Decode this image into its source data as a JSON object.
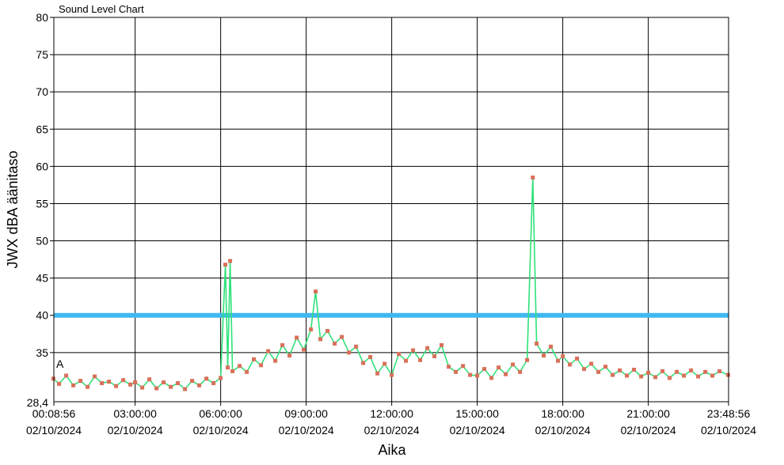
{
  "chart_data": {
    "type": "line",
    "title": "Sound Level Chart",
    "xlabel": "Aika",
    "ylabel": "JWX dBA äänitaso",
    "ylim": [
      28.4,
      80
    ],
    "yticks": [
      80,
      75,
      70,
      65,
      60,
      55,
      50,
      45,
      40,
      35
    ],
    "ymin_label": "28,4",
    "xlim": [
      "00:08:56",
      "23:48:56"
    ],
    "xticks": [
      {
        "time": "00:08:56",
        "date": "02/10/2024"
      },
      {
        "time": "03:00:00",
        "date": "02/10/2024"
      },
      {
        "time": "06:00:00",
        "date": "02/10/2024"
      },
      {
        "time": "09:00:00",
        "date": "02/10/2024"
      },
      {
        "time": "12:00:00",
        "date": "02/10/2024"
      },
      {
        "time": "15:00:00",
        "date": "02/10/2024"
      },
      {
        "time": "18:00:00",
        "date": "02/10/2024"
      },
      {
        "time": "21:00:00",
        "date": "02/10/2024"
      },
      {
        "time": "23:48:56",
        "date": "02/10/2024"
      }
    ],
    "grid": true,
    "threshold": {
      "value": 40,
      "color": "#3fb8ef"
    },
    "annotation": "A",
    "series": [
      {
        "line_color": "#2fe27a",
        "marker_color": "#d9705a",
        "points": [
          [
            "00:08",
            31.5
          ],
          [
            "00:20",
            30.8
          ],
          [
            "00:35",
            31.9
          ],
          [
            "00:50",
            30.6
          ],
          [
            "01:05",
            31.2
          ],
          [
            "01:20",
            30.4
          ],
          [
            "01:35",
            31.8
          ],
          [
            "01:50",
            30.9
          ],
          [
            "02:05",
            31.1
          ],
          [
            "02:20",
            30.5
          ],
          [
            "02:35",
            31.3
          ],
          [
            "02:50",
            30.7
          ],
          [
            "03:00",
            31.0
          ],
          [
            "03:15",
            30.3
          ],
          [
            "03:30",
            31.4
          ],
          [
            "03:45",
            30.2
          ],
          [
            "04:00",
            31.0
          ],
          [
            "04:15",
            30.4
          ],
          [
            "04:30",
            30.9
          ],
          [
            "04:45",
            30.1
          ],
          [
            "05:00",
            31.2
          ],
          [
            "05:15",
            30.6
          ],
          [
            "05:30",
            31.5
          ],
          [
            "05:45",
            30.9
          ],
          [
            "06:00",
            31.6
          ],
          [
            "06:10",
            46.8
          ],
          [
            "06:15",
            33.0
          ],
          [
            "06:20",
            47.3
          ],
          [
            "06:25",
            32.5
          ],
          [
            "06:40",
            33.2
          ],
          [
            "06:55",
            32.4
          ],
          [
            "07:10",
            34.1
          ],
          [
            "07:25",
            33.3
          ],
          [
            "07:40",
            35.2
          ],
          [
            "07:55",
            33.9
          ],
          [
            "08:10",
            36.0
          ],
          [
            "08:25",
            34.6
          ],
          [
            "08:40",
            37.0
          ],
          [
            "08:55",
            35.4
          ],
          [
            "09:10",
            38.1
          ],
          [
            "09:20",
            43.2
          ],
          [
            "09:30",
            36.8
          ],
          [
            "09:45",
            37.9
          ],
          [
            "10:00",
            36.2
          ],
          [
            "10:15",
            37.1
          ],
          [
            "10:30",
            35.0
          ],
          [
            "10:45",
            35.8
          ],
          [
            "11:00",
            33.6
          ],
          [
            "11:15",
            34.4
          ],
          [
            "11:30",
            32.2
          ],
          [
            "11:45",
            33.5
          ],
          [
            "12:00",
            32.0
          ],
          [
            "12:15",
            34.8
          ],
          [
            "12:30",
            33.9
          ],
          [
            "12:45",
            35.3
          ],
          [
            "13:00",
            34.0
          ],
          [
            "13:15",
            35.6
          ],
          [
            "13:30",
            34.5
          ],
          [
            "13:45",
            36.0
          ],
          [
            "14:00",
            33.1
          ],
          [
            "14:15",
            32.4
          ],
          [
            "14:30",
            33.2
          ],
          [
            "14:45",
            32.0
          ],
          [
            "15:00",
            31.9
          ],
          [
            "15:15",
            32.8
          ],
          [
            "15:30",
            31.6
          ],
          [
            "15:45",
            33.0
          ],
          [
            "16:00",
            32.1
          ],
          [
            "16:15",
            33.4
          ],
          [
            "16:30",
            32.4
          ],
          [
            "16:45",
            34.0
          ],
          [
            "16:57",
            58.5
          ],
          [
            "17:05",
            36.2
          ],
          [
            "17:20",
            34.6
          ],
          [
            "17:35",
            35.8
          ],
          [
            "17:50",
            33.9
          ],
          [
            "18:00",
            34.5
          ],
          [
            "18:15",
            33.4
          ],
          [
            "18:30",
            34.2
          ],
          [
            "18:45",
            32.8
          ],
          [
            "19:00",
            33.5
          ],
          [
            "19:15",
            32.4
          ],
          [
            "19:30",
            33.1
          ],
          [
            "19:45",
            32.0
          ],
          [
            "20:00",
            32.6
          ],
          [
            "20:15",
            31.9
          ],
          [
            "20:30",
            32.7
          ],
          [
            "20:45",
            31.8
          ],
          [
            "21:00",
            32.3
          ],
          [
            "21:15",
            31.7
          ],
          [
            "21:30",
            32.5
          ],
          [
            "21:45",
            31.6
          ],
          [
            "22:00",
            32.4
          ],
          [
            "22:15",
            31.9
          ],
          [
            "22:30",
            32.6
          ],
          [
            "22:45",
            31.8
          ],
          [
            "23:00",
            32.4
          ],
          [
            "23:15",
            31.9
          ],
          [
            "23:30",
            32.5
          ],
          [
            "23:48",
            32.0
          ]
        ]
      }
    ]
  }
}
